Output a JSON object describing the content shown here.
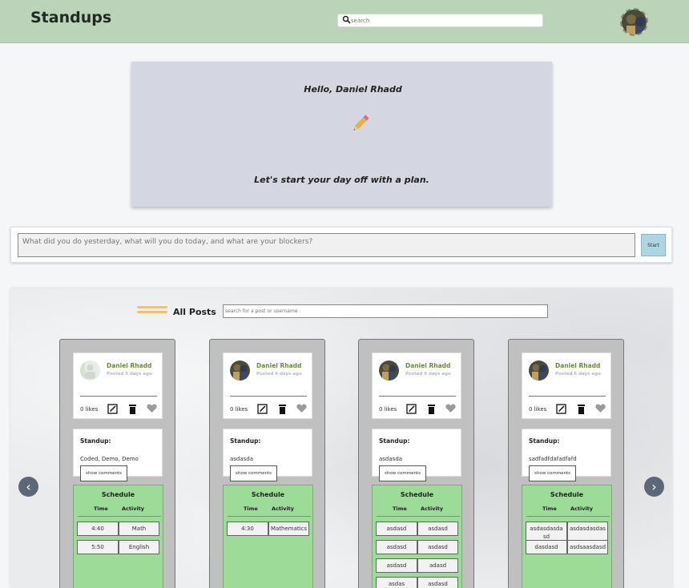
{
  "header": {
    "title": "Standups",
    "search_placeholder": "search",
    "search_icon": "search-icon",
    "avatar": "user-avatar"
  },
  "hero": {
    "greeting": "Hello, Daniel Rhadd",
    "icon": "pencil-icon",
    "tagline": "Let's start your day off with a plan."
  },
  "entry": {
    "placeholder": "What did you do yesterday, what will you do today, and what are your blockers?",
    "start_label": "Start"
  },
  "posts": {
    "title": "All Posts",
    "search_placeholder": "search for a post or username",
    "prev_label": "‹",
    "next_label": "›",
    "cards": [
      {
        "name": "Daniel Rhadd",
        "time": "Posted 5 days ago",
        "likes": "0 likes",
        "standup_label": "Standup:",
        "standup_text": "Coded, Demo, Demo",
        "comments_label": "show comments",
        "schedule_title": "Schedule",
        "time_header": "Time",
        "activity_header": "Activity",
        "rows": [
          {
            "time": "4:40",
            "activity": "Math"
          },
          {
            "time": "5:50",
            "activity": "English"
          }
        ]
      },
      {
        "name": "Daniel Rhadd",
        "time": "Posted 6 days ago",
        "likes": "0 likes",
        "standup_label": "Standup:",
        "standup_text": "asdasda",
        "comments_label": "show comments",
        "schedule_title": "Schedule",
        "time_header": "Time",
        "activity_header": "Activity",
        "rows": [
          {
            "time": "4:30",
            "activity": "Mathematics"
          }
        ]
      },
      {
        "name": "Daniel Rhadd",
        "time": "Posted 6 days ago",
        "likes": "0 likes",
        "standup_label": "Standup:",
        "standup_text": "asdasda",
        "comments_label": "show comments",
        "schedule_title": "Schedule",
        "time_header": "Time",
        "activity_header": "Activity",
        "rows": [
          {
            "time": "asdasd",
            "activity": "asdasd"
          },
          {
            "time": "asdasd",
            "activity": "asdasd"
          },
          {
            "time": "asdasd",
            "activity": "adasd"
          },
          {
            "time": "asdas",
            "activity": "asdasd"
          }
        ]
      },
      {
        "name": "Daniel Rhadd",
        "time": "Posted 6 days ago",
        "likes": "0 likes",
        "standup_label": "Standup:",
        "standup_text": "sadfadfdafadfafd",
        "comments_label": "show comments",
        "schedule_title": "Schedule",
        "time_header": "Time",
        "activity_header": "Activity",
        "rows": [
          {
            "time": "asdasdasda sd",
            "activity": "asdasdasdas"
          },
          {
            "time": "dasdasd",
            "activity": "asdsaasdasd"
          }
        ]
      }
    ]
  },
  "colors": {
    "header_bg": "#bbd3b8",
    "hero_bg": "#d4d6e2",
    "schedule_bg": "#9cdb98",
    "name_color": "#6a8a3a",
    "start_button": "#acd6e4",
    "nav_arrow": "#5b6877"
  }
}
